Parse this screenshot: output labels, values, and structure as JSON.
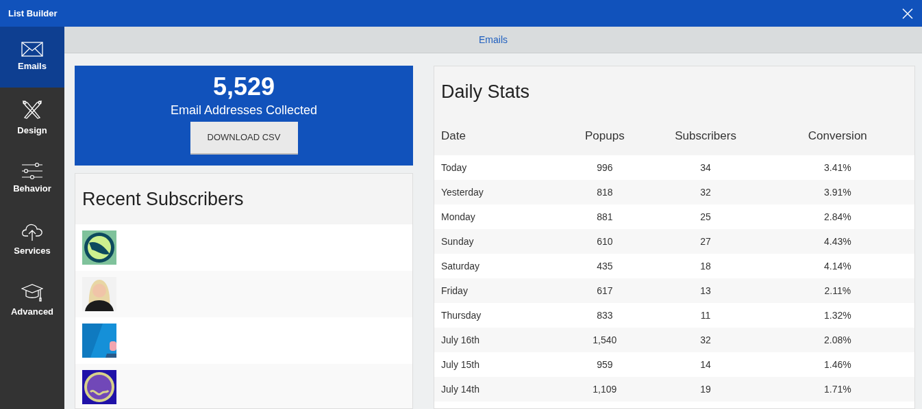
{
  "window": {
    "title": "List Builder"
  },
  "sidebar": {
    "items": [
      {
        "label": "Emails",
        "kind": "envelope",
        "selected": true
      },
      {
        "label": "Design",
        "kind": "brushes",
        "selected": false
      },
      {
        "label": "Behavior",
        "kind": "sliders",
        "selected": false
      },
      {
        "label": "Services",
        "kind": "cloud",
        "selected": false
      },
      {
        "label": "Advanced",
        "kind": "cap",
        "selected": false
      }
    ]
  },
  "section_title": "Emails",
  "summary": {
    "count": "5,529",
    "label": "Email Addresses Collected",
    "button": "DOWNLOAD CSV"
  },
  "recent_subscribers": {
    "title": "Recent Subscribers"
  },
  "daily_stats": {
    "title": "Daily Stats",
    "columns": [
      "Date",
      "Popups",
      "Subscribers",
      "Conversion"
    ],
    "rows": [
      [
        "Today",
        "996",
        "34",
        "3.41%"
      ],
      [
        "Yesterday",
        "818",
        "32",
        "3.91%"
      ],
      [
        "Monday",
        "881",
        "25",
        "2.84%"
      ],
      [
        "Sunday",
        "610",
        "27",
        "4.43%"
      ],
      [
        "Saturday",
        "435",
        "18",
        "4.14%"
      ],
      [
        "Friday",
        "617",
        "13",
        "2.11%"
      ],
      [
        "Thursday",
        "833",
        "11",
        "1.32%"
      ],
      [
        "July 16th",
        "1,540",
        "32",
        "2.08%"
      ],
      [
        "July 15th",
        "959",
        "14",
        "1.46%"
      ],
      [
        "July 14th",
        "1,109",
        "19",
        "1.71%"
      ]
    ]
  }
}
